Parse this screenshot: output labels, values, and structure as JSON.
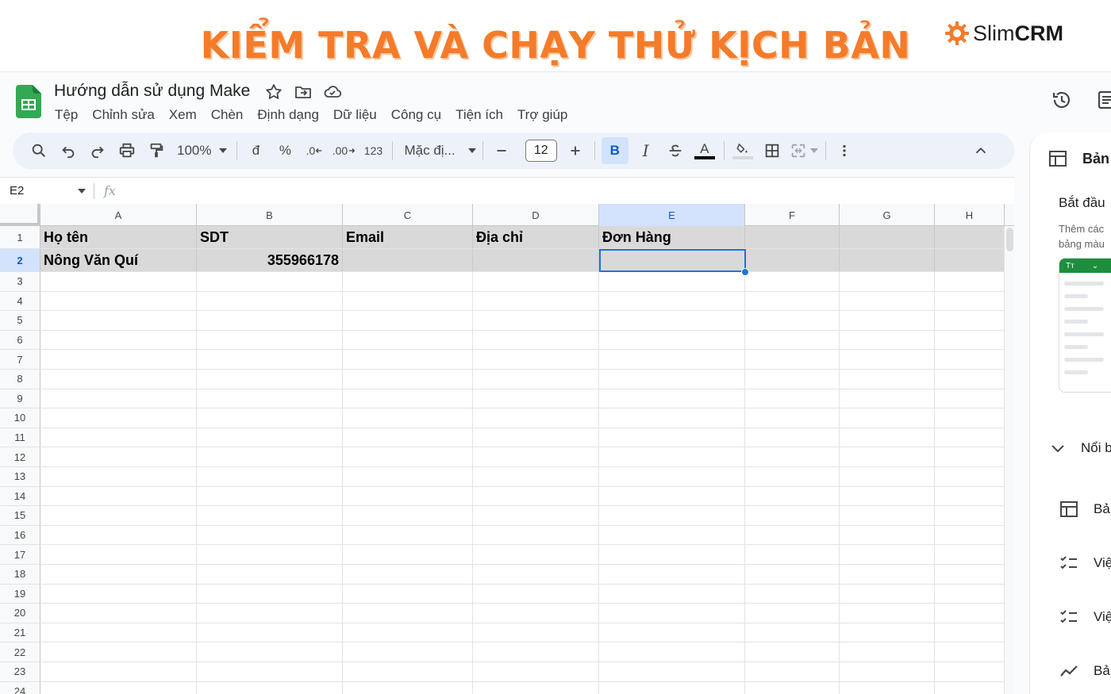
{
  "banner": {
    "title": "KIỂM TRA VÀ CHẠY THỬ KỊCH BẢN",
    "brand_prefix": "Slim",
    "brand_bold": "CRM",
    "brand_color": "#f47b2a"
  },
  "doc": {
    "title": "Hướng dẫn sử dụng Make",
    "icons": [
      "star-icon",
      "move-to-folder-icon",
      "cloud-saved-icon"
    ]
  },
  "menu": [
    "Tệp",
    "Chỉnh sửa",
    "Xem",
    "Chèn",
    "Định dạng",
    "Dữ liệu",
    "Công cụ",
    "Tiện ích",
    "Trợ giúp"
  ],
  "toolbar": {
    "zoom": "100%",
    "currency": "đ",
    "percent": "%",
    "dec_decrease": ".0",
    "dec_increase": ".00",
    "number_format": "123",
    "font": "Mặc đị...",
    "font_size": "12",
    "bold": "B",
    "italic": "I",
    "text_color_letter": "A"
  },
  "formula_bar": {
    "name_box": "E2",
    "fx": "fx"
  },
  "columns": [
    "A",
    "B",
    "C",
    "D",
    "E",
    "F",
    "G",
    "H"
  ],
  "selected_column": "E",
  "selected_row": "2",
  "rows": [
    {
      "n": "1",
      "cells": [
        "Họ tên",
        "SDT",
        "Email",
        "Địa chỉ",
        "Đơn Hàng",
        "",
        "",
        ""
      ]
    },
    {
      "n": "2",
      "cells": [
        "Nông Văn Quí",
        "355966178",
        "",
        "",
        "",
        "",
        "",
        ""
      ]
    },
    {
      "n": "3"
    },
    {
      "n": "4"
    },
    {
      "n": "5"
    },
    {
      "n": "6"
    },
    {
      "n": "7"
    },
    {
      "n": "8"
    },
    {
      "n": "9"
    },
    {
      "n": "10"
    },
    {
      "n": "11"
    },
    {
      "n": "12"
    },
    {
      "n": "13"
    },
    {
      "n": "14"
    },
    {
      "n": "15"
    },
    {
      "n": "16"
    },
    {
      "n": "17"
    },
    {
      "n": "18"
    },
    {
      "n": "19"
    },
    {
      "n": "20"
    },
    {
      "n": "21"
    },
    {
      "n": "22"
    },
    {
      "n": "23"
    },
    {
      "n": "24"
    }
  ],
  "side_panel": {
    "header": "Bản",
    "start": "Bắt đầu",
    "desc_line1": "Thêm các",
    "desc_line2": "bảng màu",
    "preview_label": "Tт",
    "collapse_label": "Nổi b",
    "items": [
      {
        "icon": "table-icon",
        "label": "Bả"
      },
      {
        "icon": "checklist-icon",
        "label": "Việ"
      },
      {
        "icon": "checklist-icon",
        "label": "Việ"
      },
      {
        "icon": "trend-chart-icon",
        "label": "Bả"
      }
    ]
  }
}
